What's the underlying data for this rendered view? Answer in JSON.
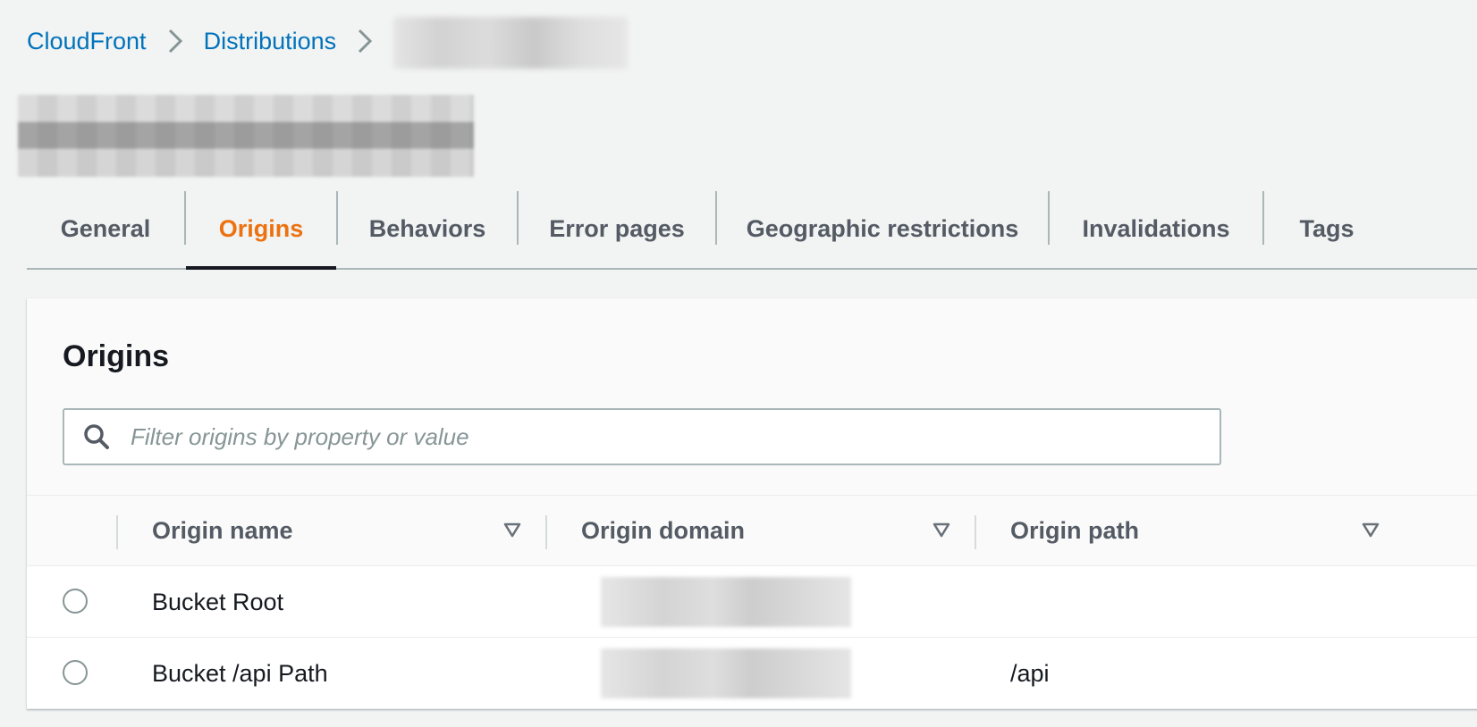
{
  "breadcrumb": {
    "items": [
      "CloudFront",
      "Distributions"
    ],
    "current_redacted": true
  },
  "page_title_redacted": true,
  "tabs": [
    {
      "label": "General",
      "active": false
    },
    {
      "label": "Origins",
      "active": true
    },
    {
      "label": "Behaviors",
      "active": false
    },
    {
      "label": "Error pages",
      "active": false
    },
    {
      "label": "Geographic restrictions",
      "active": false
    },
    {
      "label": "Invalidations",
      "active": false
    },
    {
      "label": "Tags",
      "active": false
    }
  ],
  "panel": {
    "title": "Origins",
    "search_placeholder": "Filter origins by property or value",
    "columns": [
      "Origin name",
      "Origin domain",
      "Origin path"
    ],
    "rows": [
      {
        "name": "Bucket Root",
        "domain_redacted": true,
        "path": ""
      },
      {
        "name": "Bucket /api Path",
        "domain_redacted": true,
        "path": "/api"
      }
    ]
  },
  "colors": {
    "link": "#0073bb",
    "active_tab": "#ec7211",
    "background": "#f2f3f3",
    "text": "#16191f",
    "muted_text": "#545b64"
  },
  "icons": [
    "chevron-right-icon",
    "search-icon",
    "sort-caret-icon",
    "radio-icon"
  ]
}
